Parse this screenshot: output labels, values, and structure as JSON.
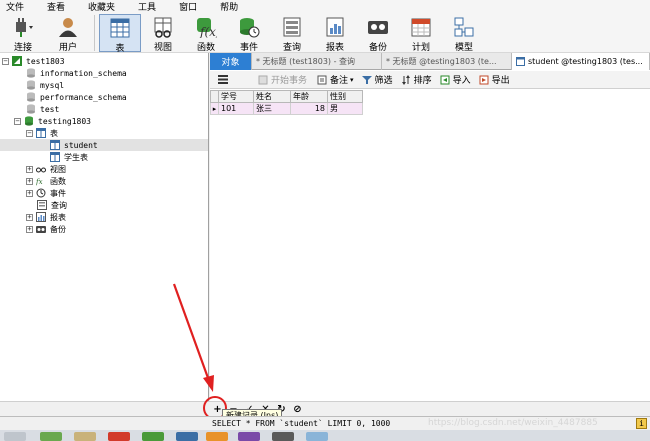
{
  "menu": [
    "文件",
    "查看",
    "收藏夹",
    "工具",
    "窗口",
    "帮助"
  ],
  "toolbar": {
    "connect": "连接",
    "user": "用户",
    "table": "表",
    "view": "视图",
    "function": "函数",
    "event": "事件",
    "query": "查询",
    "report": "报表",
    "backup": "备份",
    "schedule": "计划",
    "model": "模型"
  },
  "tree": {
    "connection": "test1803",
    "db1": "information_schema",
    "db2": "mysql",
    "db3": "performance_schema",
    "db4": "test",
    "db5": "testing1803",
    "tables_node": "表",
    "table1": "student",
    "table2": "学生表",
    "views": "视图",
    "functions": "函数",
    "events": "事件",
    "queries": "查询",
    "reports": "报表",
    "backups": "备份"
  },
  "tabs": {
    "objects": "对象",
    "tab1": "* 无标题 (test1803) - 查询",
    "tab2": "* 无标题 @testing1803 (te...",
    "tab3": "student @testing1803 (tes..."
  },
  "subbar": {
    "begin_tx": "开始事务",
    "memo": "备注",
    "filter": "筛选",
    "sort": "排序",
    "import": "导入",
    "export": "导出"
  },
  "grid": {
    "columns": [
      "学号",
      "姓名",
      "年龄",
      "性别"
    ],
    "row": {
      "marker": "▸",
      "id": "101",
      "name": "张三",
      "age": "18",
      "sex": "男"
    }
  },
  "tooltip": "新建记录 (Ins)",
  "status": {
    "sql": "SELECT * FROM `student` LIMIT 0, 1000"
  },
  "watermark": "https://blog.csdn.net/weixin_4487885",
  "colors": {
    "objects_tab": "#2d7fd3",
    "selected_row": "#f6e4f6",
    "annotation": "#e02020"
  }
}
